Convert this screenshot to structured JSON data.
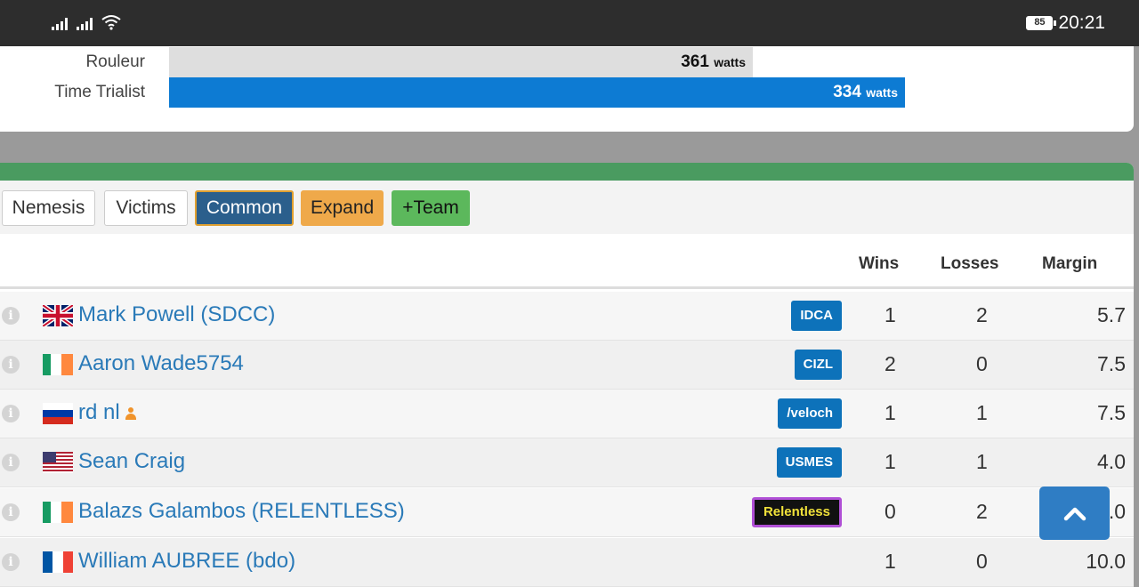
{
  "status_bar": {
    "time": "20:21",
    "battery": "85",
    "icons": [
      "signal-icon",
      "signal-icon",
      "wifi-icon",
      "battery-icon"
    ]
  },
  "power": {
    "rows": [
      {
        "label": "Rouleur",
        "value": "361",
        "unit": "watts",
        "color": "#dedede"
      },
      {
        "label": "Time Trialist",
        "value": "334",
        "unit": "watts",
        "color": "#0d7bd3"
      }
    ]
  },
  "toolbar": {
    "nemesis": "Nemesis",
    "victims": "Victims",
    "common": "Common",
    "expand": "Expand",
    "team": "+Team"
  },
  "table": {
    "headers": {
      "wins": "Wins",
      "losses": "Losses",
      "margin": "Margin"
    },
    "rows": [
      {
        "flag": "gb-flag-icon",
        "name": "Mark Powell (SDCC)",
        "team": "IDCA",
        "wins": "1",
        "losses": "2",
        "margin": "5.7"
      },
      {
        "flag": "ie-flag-icon",
        "name": "Aaron Wade5754",
        "team": "CIZL",
        "wins": "2",
        "losses": "0",
        "margin": "7.5"
      },
      {
        "flag": "ru-flag-icon",
        "name": "rd nl",
        "team": "/veloch",
        "wins": "1",
        "losses": "1",
        "margin": "7.5"
      },
      {
        "flag": "us-flag-icon",
        "name": "Sean Craig",
        "team": "USMES",
        "wins": "1",
        "losses": "1",
        "margin": "4.0"
      },
      {
        "flag": "ie-flag-icon",
        "name": "Balazs Galambos (RELENTLESS)",
        "team": "Relentless",
        "wins": "0",
        "losses": "2",
        "margin": ".0"
      },
      {
        "flag": "fr-flag-icon",
        "name": "William AUBREE (bdo)",
        "team": "",
        "wins": "1",
        "losses": "0",
        "margin": "10.0"
      }
    ]
  },
  "colors": {
    "accent": "#0d7bd3",
    "panel_top": "#4a9b60",
    "link": "#2a7ab8"
  }
}
